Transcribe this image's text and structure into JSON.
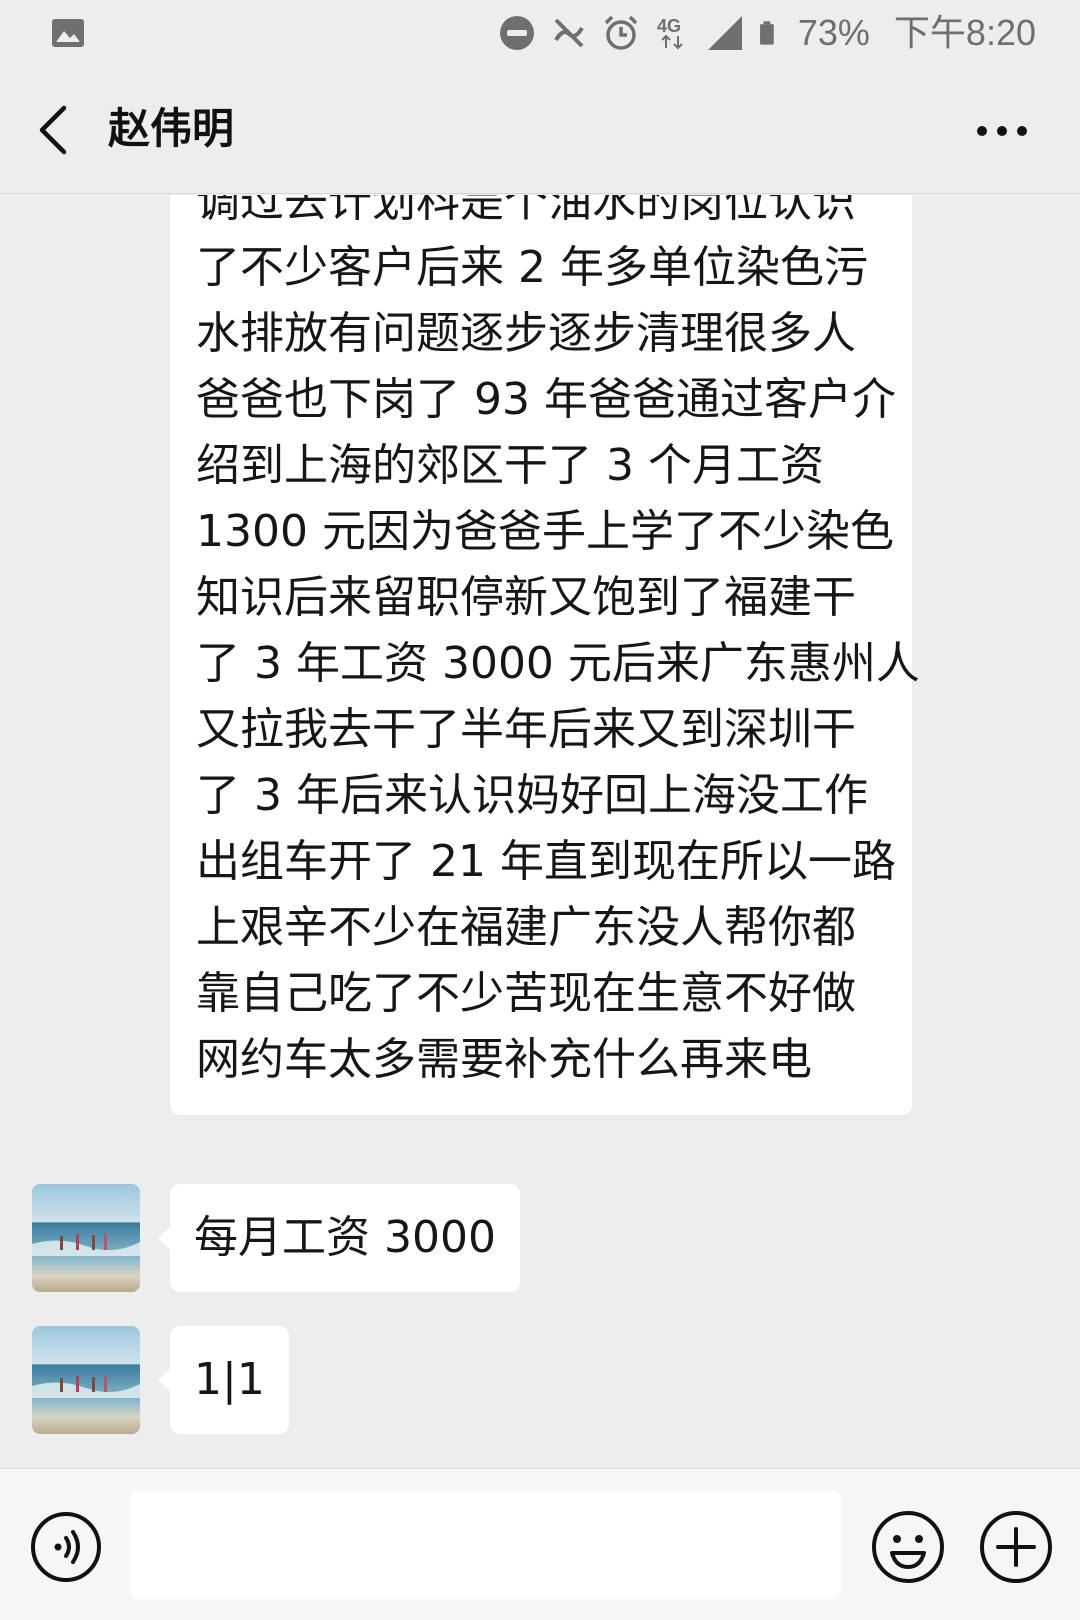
{
  "status_bar": {
    "battery_percent": "73%",
    "time": "下午8:20",
    "network": "4G",
    "icons": [
      "gallery-icon",
      "do-not-disturb-icon",
      "vibrate-off-icon",
      "alarm-icon",
      "network-4g-icon",
      "signal-icon",
      "battery-icon"
    ]
  },
  "header": {
    "title": "赵伟明",
    "back_icon": "chevron-left-icon",
    "more_icon": "more-dots-icon"
  },
  "messages": [
    {
      "sender": "other",
      "lines": [
        "调过去计划科是个油水的岗位认识",
        "了不少客户后来 2 年多单位染色污",
        "水排放有问题逐步逐步清理很多人",
        "爸爸也下岗了 93 年爸爸通过客户介",
        "绍到上海的郊区干了 3 个月工资",
        "1300 元因为爸爸手上学了不少染色",
        "知识后来留职停新又饱到了福建干",
        "了 3 年工资 3000 元后来广东惠州人",
        "又拉我去干了半年后来又到深圳干",
        "了 3 年后来认识妈好回上海没工作",
        "出组车开了 21 年直到现在所以一路",
        "上艰辛不少在福建广东没人帮你都",
        "靠自己吃了不少苦现在生意不好做",
        "网约车太多需要补充什么再来电"
      ]
    },
    {
      "sender": "other",
      "text": "每月工资 3000"
    },
    {
      "sender": "other",
      "text": "1|1"
    }
  ],
  "input_bar": {
    "voice_icon": "voice-icon",
    "input_value": "",
    "emoji_icon": "emoji-icon",
    "plus_icon": "plus-icon"
  },
  "colors": {
    "background": "#ededed",
    "bubble": "#ffffff",
    "text": "#161616",
    "icon_gray": "#6f6f6f"
  }
}
